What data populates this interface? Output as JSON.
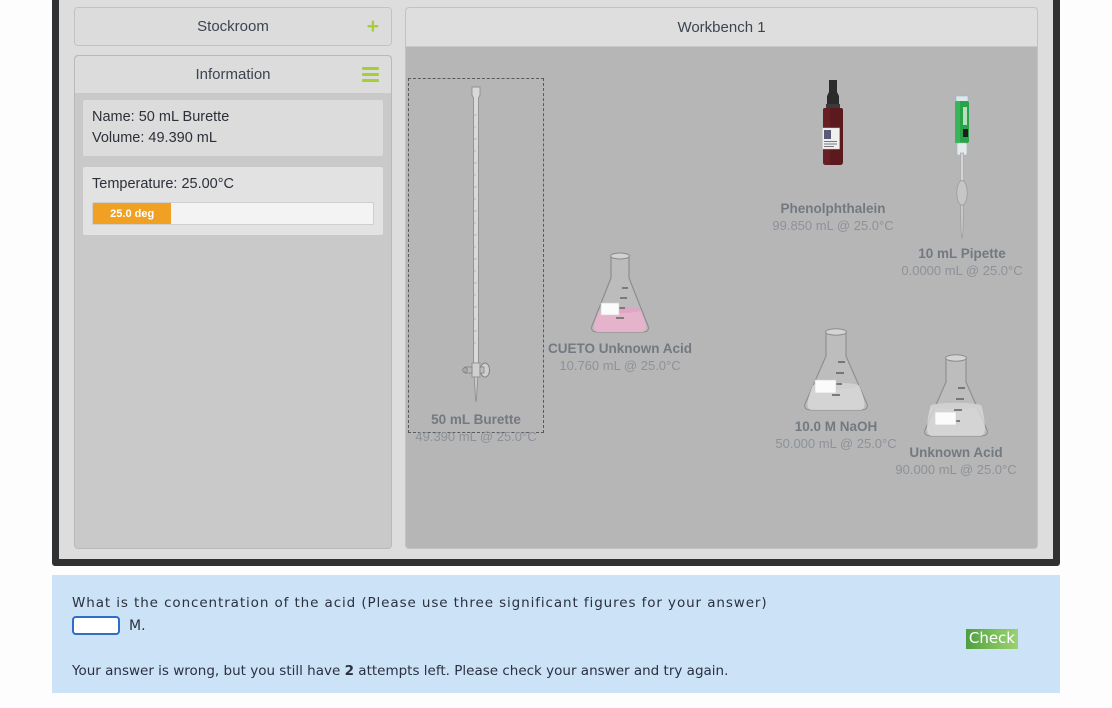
{
  "left_panel": {
    "stockroom": {
      "title": "Stockroom",
      "icon": "plus-icon"
    },
    "information": {
      "title": "Information",
      "icon": "hamburger-menu-icon"
    },
    "selected_item": {
      "name_line": "Name: 50 mL Burette",
      "volume_line": "Volume: 49.390 mL"
    },
    "temperature": {
      "label": "Temperature: 25.00°C",
      "bar_value": "25.0 deg",
      "bar_fill_percent": 28
    }
  },
  "workbench": {
    "title": "Workbench 1",
    "items": [
      {
        "id": "burette",
        "name": "50 mL Burette",
        "sub": "49.390 mL @ 25.0°C",
        "selected": true
      },
      {
        "id": "cueto-flask",
        "name": "CUETO Unknown Acid",
        "sub": "10.760 mL @ 25.0°C",
        "selected": false
      },
      {
        "id": "phenolphthalein",
        "name": "Phenolphthalein",
        "sub": "99.850 mL @ 25.0°C",
        "selected": false
      },
      {
        "id": "pipette",
        "name": "10 mL Pipette",
        "sub": "0.0000 mL @ 25.0°C",
        "selected": false
      },
      {
        "id": "naoh-flask",
        "name": "10.0 M NaOH",
        "sub": "50.000 mL @ 25.0°C",
        "selected": false
      },
      {
        "id": "unknown-acid-flask",
        "name": "Unknown Acid",
        "sub": "90.000 mL @ 25.0°C",
        "selected": false
      }
    ]
  },
  "question": {
    "prompt": "What is the concentration of the acid  (Please use three significant figures for your answer)",
    "answer_value": "",
    "answer_placeholder": "",
    "unit": "M.",
    "check_label": "Check",
    "feedback_before": "Your answer is wrong, but you still have ",
    "feedback_count": "2",
    "feedback_after": " attempts left. Please check your answer and try again."
  },
  "colors": {
    "accent_green": "#a6ce39",
    "temp_orange": "#f0a124",
    "question_bg": "#cbe2f7",
    "input_border": "#2f6ec4",
    "bench_gray": "#b6b6b6"
  }
}
